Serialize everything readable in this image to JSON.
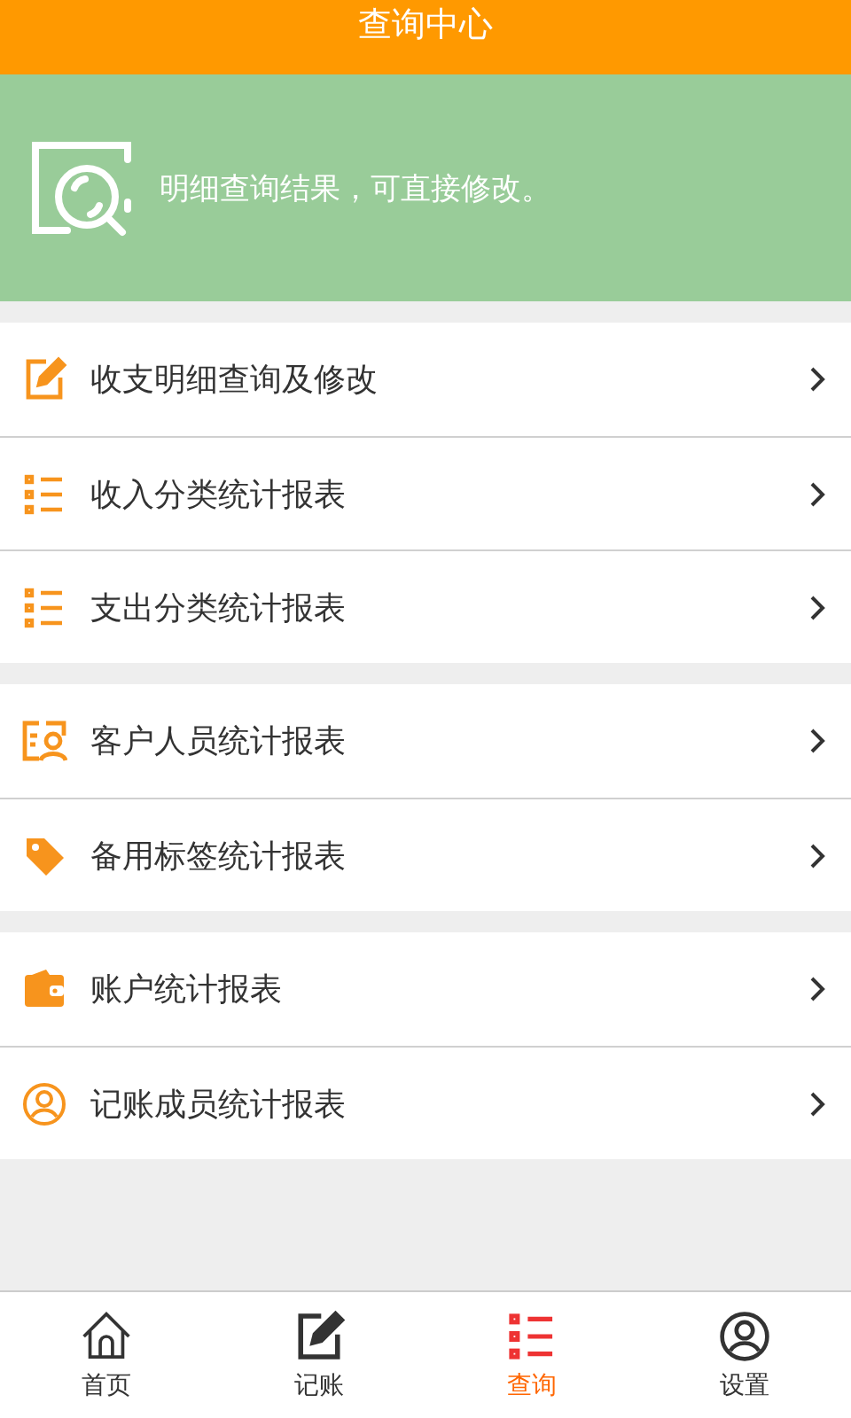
{
  "header": {
    "title": "查询中心"
  },
  "banner": {
    "text": "明细查询结果，可直接修改。"
  },
  "sections": [
    {
      "items": [
        {
          "label": "收支明细查询及修改",
          "kind": "edit"
        },
        {
          "label": "收入分类统计报表",
          "kind": "list"
        },
        {
          "label": "支出分类统计报表",
          "kind": "list"
        }
      ]
    },
    {
      "items": [
        {
          "label": "客户人员统计报表",
          "kind": "contact"
        },
        {
          "label": "备用标签统计报表",
          "kind": "tag"
        }
      ]
    },
    {
      "items": [
        {
          "label": "账户统计报表",
          "kind": "wallet"
        },
        {
          "label": "记账成员统计报表",
          "kind": "member"
        }
      ]
    }
  ],
  "bottom_nav": [
    {
      "label": "首页",
      "kind": "home",
      "selected": false
    },
    {
      "label": "记账",
      "kind": "edit",
      "selected": false
    },
    {
      "label": "查询",
      "kind": "list",
      "selected": true
    },
    {
      "label": "设置",
      "kind": "member",
      "selected": false
    }
  ]
}
